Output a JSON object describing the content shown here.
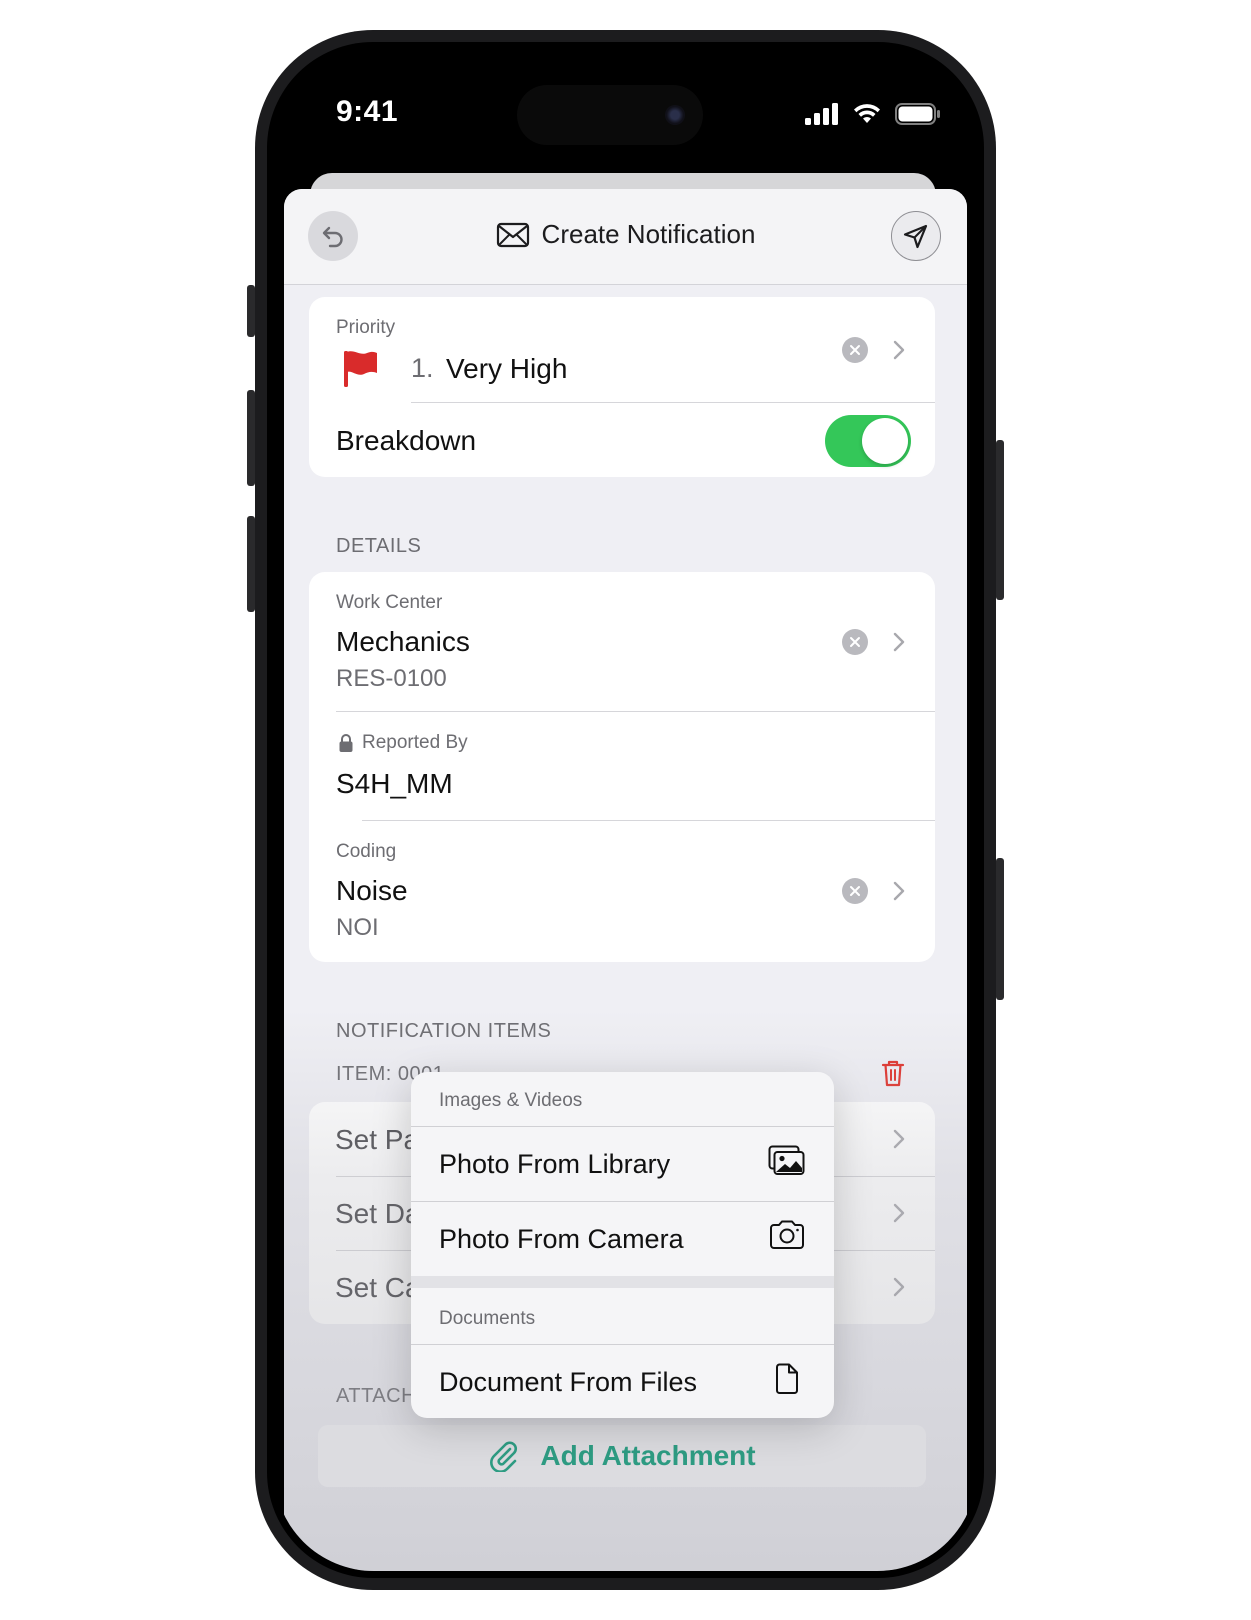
{
  "status_bar": {
    "time": "9:41"
  },
  "navbar": {
    "title": "Create Notification",
    "mail_icon": "envelope-icon",
    "back_icon": "undo-icon",
    "send_icon": "paper-plane-icon"
  },
  "priority_card": {
    "label": "Priority",
    "number": "1.",
    "value": "Very High",
    "flag_color": "#d92b2b",
    "breakdown_label": "Breakdown",
    "breakdown_on": true
  },
  "details": {
    "header": "DETAILS",
    "work_center": {
      "label": "Work Center",
      "value": "Mechanics",
      "code": "RES-0100"
    },
    "reported_by": {
      "label": "Reported By",
      "value": "S4H_MM"
    },
    "coding": {
      "label": "Coding",
      "value": "Noise",
      "code": "NOI"
    }
  },
  "notification_items": {
    "header": "NOTIFICATION ITEMS",
    "item_label": "ITEM: 0001",
    "rows": [
      "Set Pa",
      "Set Da",
      "Set Ca"
    ]
  },
  "attachments": {
    "header": "ATTACH",
    "button_label": "Add Attachment"
  },
  "menu": {
    "section1": "Images & Videos",
    "items1": [
      {
        "label": "Photo From Library",
        "icon": "photo-library-icon"
      },
      {
        "label": "Photo From Camera",
        "icon": "camera-icon"
      }
    ],
    "section2": "Documents",
    "items2": [
      {
        "label": "Document From Files",
        "icon": "document-icon"
      }
    ]
  },
  "colors": {
    "accent_green": "#34c759",
    "attach_teal": "#2e9c83",
    "delete_red": "#e0332c"
  }
}
